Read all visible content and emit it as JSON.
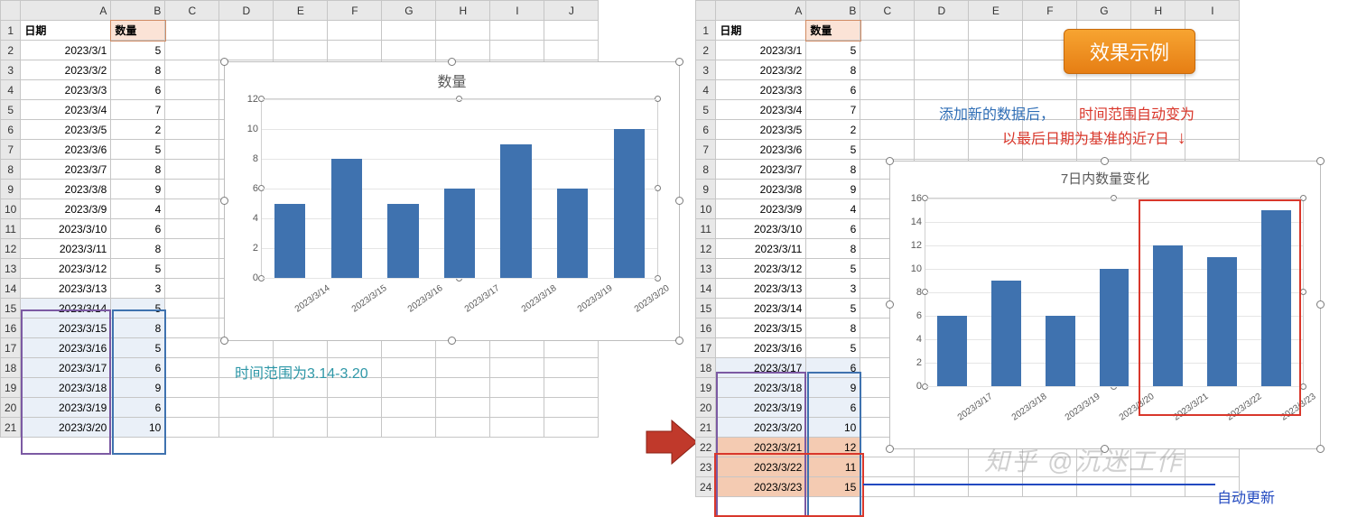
{
  "left": {
    "headers": {
      "date": "日期",
      "qty": "数量"
    },
    "cols": [
      "A",
      "B",
      "C",
      "D",
      "E",
      "F",
      "G",
      "H",
      "I",
      "J"
    ],
    "rows": [
      {
        "r": 1
      },
      {
        "r": 2,
        "d": "2023/3/1",
        "q": 5
      },
      {
        "r": 3,
        "d": "2023/3/2",
        "q": 8
      },
      {
        "r": 4,
        "d": "2023/3/3",
        "q": 6
      },
      {
        "r": 5,
        "d": "2023/3/4",
        "q": 7
      },
      {
        "r": 6,
        "d": "2023/3/5",
        "q": 2
      },
      {
        "r": 7,
        "d": "2023/3/6",
        "q": 5
      },
      {
        "r": 8,
        "d": "2023/3/7",
        "q": 8
      },
      {
        "r": 9,
        "d": "2023/3/8",
        "q": 9
      },
      {
        "r": 10,
        "d": "2023/3/9",
        "q": 4
      },
      {
        "r": 11,
        "d": "2023/3/10",
        "q": 6
      },
      {
        "r": 12,
        "d": "2023/3/11",
        "q": 8
      },
      {
        "r": 13,
        "d": "2023/3/12",
        "q": 5
      },
      {
        "r": 14,
        "d": "2023/3/13",
        "q": 3
      },
      {
        "r": 15,
        "d": "2023/3/14",
        "q": 5,
        "hl": "blue"
      },
      {
        "r": 16,
        "d": "2023/3/15",
        "q": 8,
        "hl": "blue"
      },
      {
        "r": 17,
        "d": "2023/3/16",
        "q": 5,
        "hl": "blue"
      },
      {
        "r": 18,
        "d": "2023/3/17",
        "q": 6,
        "hl": "blue"
      },
      {
        "r": 19,
        "d": "2023/3/18",
        "q": 9,
        "hl": "blue"
      },
      {
        "r": 20,
        "d": "2023/3/19",
        "q": 6,
        "hl": "blue"
      },
      {
        "r": 21,
        "d": "2023/3/20",
        "q": 10,
        "hl": "blue"
      }
    ],
    "caption": "时间范围为3.14-3.20"
  },
  "right": {
    "headers": {
      "date": "日期",
      "qty": "数量"
    },
    "cols": [
      "A",
      "B",
      "C",
      "D",
      "E",
      "F",
      "G",
      "H",
      "I"
    ],
    "rows": [
      {
        "r": 1
      },
      {
        "r": 2,
        "d": "2023/3/1",
        "q": 5
      },
      {
        "r": 3,
        "d": "2023/3/2",
        "q": 8
      },
      {
        "r": 4,
        "d": "2023/3/3",
        "q": 6
      },
      {
        "r": 5,
        "d": "2023/3/4",
        "q": 7
      },
      {
        "r": 6,
        "d": "2023/3/5",
        "q": 2
      },
      {
        "r": 7,
        "d": "2023/3/6",
        "q": 5
      },
      {
        "r": 8,
        "d": "2023/3/7",
        "q": 8
      },
      {
        "r": 9,
        "d": "2023/3/8",
        "q": 9
      },
      {
        "r": 10,
        "d": "2023/3/9",
        "q": 4
      },
      {
        "r": 11,
        "d": "2023/3/10",
        "q": 6
      },
      {
        "r": 12,
        "d": "2023/3/11",
        "q": 8
      },
      {
        "r": 13,
        "d": "2023/3/12",
        "q": 5
      },
      {
        "r": 14,
        "d": "2023/3/13",
        "q": 3
      },
      {
        "r": 15,
        "d": "2023/3/14",
        "q": 5
      },
      {
        "r": 16,
        "d": "2023/3/15",
        "q": 8
      },
      {
        "r": 17,
        "d": "2023/3/16",
        "q": 5
      },
      {
        "r": 18,
        "d": "2023/3/17",
        "q": 6,
        "hl": "blue"
      },
      {
        "r": 19,
        "d": "2023/3/18",
        "q": 9,
        "hl": "blue"
      },
      {
        "r": 20,
        "d": "2023/3/19",
        "q": 6,
        "hl": "blue"
      },
      {
        "r": 21,
        "d": "2023/3/20",
        "q": 10,
        "hl": "blue"
      },
      {
        "r": 22,
        "d": "2023/3/21",
        "q": 12,
        "hl": "orange"
      },
      {
        "r": 23,
        "d": "2023/3/22",
        "q": 11,
        "hl": "orange"
      },
      {
        "r": 24,
        "d": "2023/3/23",
        "q": 15,
        "hl": "orange"
      }
    ],
    "banner": "效果示例",
    "caption_blue": "添加新的数据后，",
    "caption_red1": "时间范围自动变为",
    "caption_red2": "以最后日期为基准的近7日",
    "arrow_down": "↓",
    "auto_update": "自动更新",
    "watermark": "知乎 @沉迷工作"
  },
  "chart_data": [
    {
      "id": "chart_left",
      "type": "bar",
      "title": "数量",
      "categories": [
        "2023/3/14",
        "2023/3/15",
        "2023/3/16",
        "2023/3/17",
        "2023/3/18",
        "2023/3/19",
        "2023/3/20"
      ],
      "values": [
        5,
        8,
        5,
        6,
        9,
        6,
        10
      ],
      "xlabel": "",
      "ylabel": "",
      "ylim": [
        0,
        12
      ],
      "ystep": 2
    },
    {
      "id": "chart_right",
      "type": "bar",
      "title": "7日内数量变化",
      "categories": [
        "2023/3/17",
        "2023/3/18",
        "2023/3/19",
        "2023/3/20",
        "2023/3/21",
        "2023/3/22",
        "2023/3/23"
      ],
      "values": [
        6,
        9,
        6,
        10,
        12,
        11,
        15
      ],
      "xlabel": "",
      "ylabel": "",
      "ylim": [
        0,
        16
      ],
      "ystep": 2
    }
  ]
}
